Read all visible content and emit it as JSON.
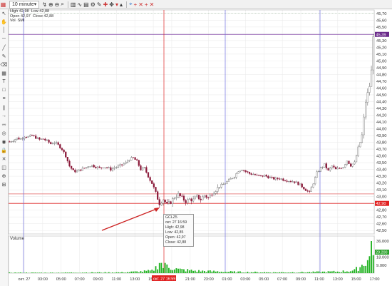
{
  "toolbar": {
    "interval": "10 minute",
    "icons": [
      "line-tool-icon",
      "zoom-in-icon",
      "zoom-out-icon",
      "search-icon",
      "chart-type-icon",
      "indicator-icon",
      "template-icon",
      "settings-icon",
      "draw-icon",
      "crosshair-icon",
      "move-icon",
      "arrow-down-icon",
      "arrow-up-icon",
      "cross-icon",
      "add-icon",
      "pointer-icon",
      "add-icon-2",
      "cross-icon-2",
      "add-icon-3",
      "cross-icon-3"
    ]
  },
  "sidebar_icons": [
    "cursor-icon",
    "pan-icon",
    "line-icon",
    "hline-icon",
    "trend-icon",
    "pencil-icon",
    "eraser-icon",
    "calendar-icon",
    "text-icon",
    "shape-icon",
    "fib-icon",
    "channel-icon",
    "arrow-icon",
    "measure-icon",
    "magnet-icon",
    "eye-icon",
    "lock-icon",
    "trash-icon",
    "layers-icon",
    "zoom-icon",
    "grid-icon"
  ],
  "legend": {
    "high_label": "High",
    "high_value": "42,98",
    "low_label": "Low",
    "low_value": "42,88",
    "open_label": "Open",
    "open_value": "42,97",
    "close_label": "Close",
    "close_value": "42,88",
    "vol_label": "Vol",
    "vol_value": "SMI"
  },
  "tooltip": {
    "symbol": "GCLZ5",
    "date": "окт. 27 16:59",
    "high": "High: 42,98",
    "low": "Low: 42,85",
    "open": "Open: 42,97",
    "close": "Close: 42,88"
  },
  "volume_label": "Volume",
  "price_badges": {
    "last": "45,39",
    "cursor": "42,90"
  },
  "volume_badge": "20.200",
  "cursor_time_badge": "окт. 27 16:59",
  "colors": {
    "up": "#6a6a6a",
    "down": "#8b1a3a",
    "volume": "#22b322",
    "crosshair": "#dd2222",
    "vertical_markers": "#7070e0",
    "badge_red": "#e02020",
    "arrow": "#cc2222"
  },
  "chart_data": {
    "type": "candlestick",
    "y_ticks": [
      "45,70",
      "45,60",
      "45,50",
      "45,40",
      "45,30",
      "45,20",
      "45,10",
      "45,00",
      "44,90",
      "44,80",
      "44,70",
      "44,60",
      "44,50",
      "44,40",
      "44,30",
      "44,20",
      "44,10",
      "44,00",
      "43,90",
      "43,80",
      "43,70",
      "43,60",
      "43,50",
      "43,40",
      "43,30",
      "43,20",
      "43,10",
      "43,00",
      "42,90",
      "42,80",
      "42,70",
      "42,60",
      "42,50"
    ],
    "ylim": [
      42.45,
      45.75
    ],
    "x_ticks": [
      "окт. 27",
      "03:00",
      "05:00",
      "07:00",
      "09:00",
      "11:00",
      "13:00",
      "15:00",
      "19:00",
      "21:00",
      "23:00",
      "01:00",
      "03:00",
      "05:00",
      "07:00",
      "09:00",
      "11:00",
      "13:00",
      "15:00",
      "17:00"
    ],
    "volume_ticks": [
      "36.000",
      "18.000",
      "9.000"
    ],
    "volume_max": 40000,
    "horizontal_lines": [
      {
        "value": 45.39,
        "color": "#7a3aa0"
      },
      {
        "value": 43.04,
        "color": "#e06060"
      },
      {
        "value": 42.9,
        "color": "#dd2222"
      }
    ],
    "price_path": [
      [
        0,
        43.81
      ],
      [
        2,
        43.83
      ],
      [
        4,
        43.86
      ],
      [
        6,
        43.85
      ],
      [
        8,
        43.89
      ],
      [
        10,
        43.88
      ],
      [
        12,
        43.9
      ],
      [
        14,
        43.87
      ],
      [
        16,
        43.84
      ],
      [
        18,
        43.85
      ],
      [
        20,
        43.82
      ],
      [
        22,
        43.78
      ],
      [
        24,
        43.8
      ],
      [
        26,
        43.76
      ],
      [
        28,
        43.7
      ],
      [
        30,
        43.6
      ],
      [
        32,
        43.45
      ],
      [
        34,
        43.38
      ],
      [
        36,
        43.37
      ],
      [
        38,
        43.4
      ],
      [
        40,
        43.42
      ],
      [
        42,
        43.45
      ],
      [
        44,
        43.46
      ],
      [
        46,
        43.44
      ],
      [
        48,
        43.42
      ],
      [
        50,
        43.44
      ],
      [
        52,
        43.43
      ],
      [
        54,
        43.4
      ],
      [
        56,
        43.43
      ],
      [
        58,
        43.44
      ],
      [
        60,
        43.47
      ],
      [
        62,
        43.5
      ],
      [
        64,
        43.55
      ],
      [
        66,
        43.57
      ],
      [
        68,
        43.52
      ],
      [
        70,
        43.4
      ],
      [
        72,
        43.42
      ],
      [
        74,
        43.3
      ],
      [
        76,
        43.2
      ],
      [
        78,
        43.05
      ],
      [
        80,
        42.9
      ],
      [
        82,
        42.96
      ],
      [
        84,
        42.88
      ],
      [
        86,
        42.92
      ],
      [
        88,
        42.99
      ],
      [
        90,
        43.03
      ],
      [
        92,
        42.98
      ],
      [
        94,
        42.93
      ],
      [
        96,
        42.96
      ],
      [
        98,
        42.95
      ],
      [
        100,
        43.0
      ],
      [
        102,
        42.96
      ],
      [
        104,
        43.02
      ],
      [
        106,
        42.98
      ],
      [
        108,
        43.05
      ],
      [
        110,
        43.1
      ],
      [
        112,
        43.15
      ],
      [
        114,
        43.18
      ],
      [
        116,
        43.22
      ],
      [
        118,
        43.26
      ],
      [
        120,
        43.3
      ],
      [
        122,
        43.38
      ],
      [
        124,
        43.4
      ],
      [
        126,
        43.37
      ],
      [
        128,
        43.34
      ],
      [
        130,
        43.33
      ],
      [
        132,
        43.31
      ],
      [
        134,
        43.3
      ],
      [
        136,
        43.31
      ],
      [
        138,
        43.29
      ],
      [
        140,
        43.27
      ],
      [
        142,
        43.26
      ],
      [
        144,
        43.27
      ],
      [
        146,
        43.25
      ],
      [
        148,
        43.24
      ],
      [
        150,
        43.23
      ],
      [
        152,
        43.22
      ],
      [
        154,
        43.19
      ],
      [
        156,
        43.15
      ],
      [
        158,
        43.1
      ],
      [
        160,
        43.06
      ],
      [
        162,
        43.2
      ],
      [
        164,
        43.35
      ],
      [
        166,
        43.42
      ],
      [
        168,
        43.47
      ],
      [
        170,
        43.38
      ],
      [
        172,
        43.45
      ],
      [
        174,
        43.4
      ],
      [
        176,
        43.42
      ],
      [
        178,
        43.44
      ],
      [
        180,
        43.53
      ],
      [
        182,
        43.46
      ],
      [
        184,
        43.5
      ],
      [
        186,
        43.7
      ],
      [
        188,
        43.9
      ],
      [
        190,
        44.4
      ],
      [
        192,
        44.63
      ],
      [
        193,
        44.85
      ],
      [
        194,
        45.39
      ]
    ],
    "bar_count": 195,
    "volume_profile": [
      [
        0,
        600
      ],
      [
        20,
        500
      ],
      [
        60,
        900
      ],
      [
        70,
        1800
      ],
      [
        76,
        2600
      ],
      [
        78,
        6000
      ],
      [
        80,
        14000
      ],
      [
        82,
        7000
      ],
      [
        84,
        9000
      ],
      [
        86,
        6500
      ],
      [
        88,
        5500
      ],
      [
        90,
        4000
      ],
      [
        100,
        2500
      ],
      [
        120,
        1400
      ],
      [
        140,
        900
      ],
      [
        160,
        1100
      ],
      [
        176,
        1800
      ],
      [
        184,
        3000
      ],
      [
        188,
        9000
      ],
      [
        190,
        14000
      ],
      [
        192,
        16000
      ],
      [
        193,
        36000
      ],
      [
        194,
        20200
      ]
    ]
  }
}
